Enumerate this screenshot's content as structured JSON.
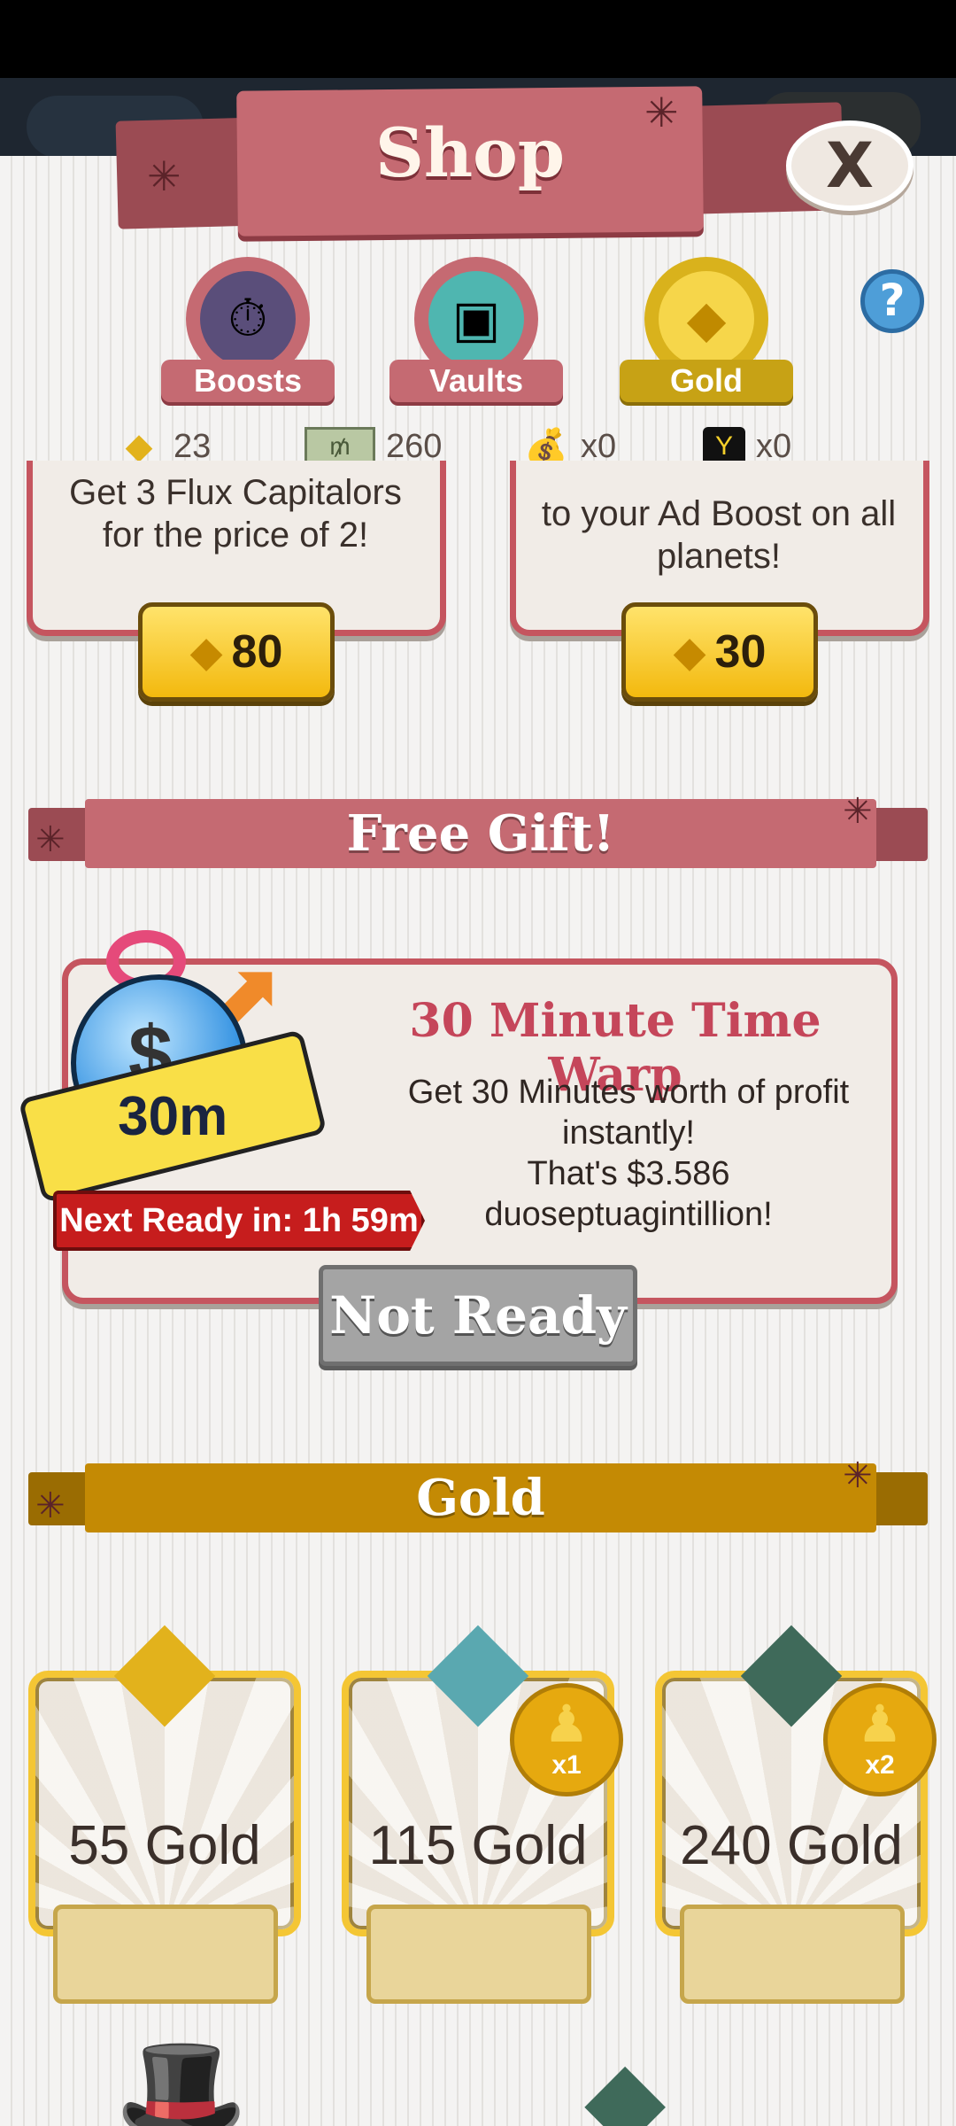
{
  "header": {
    "title": "Shop"
  },
  "tabs": [
    {
      "label": "Boosts",
      "icon": "boost-stopwatch-icon"
    },
    {
      "label": "Vaults",
      "icon": "vault-icon"
    },
    {
      "label": "Gold",
      "icon": "gold-gem-icon",
      "active": true
    }
  ],
  "currencies": [
    {
      "icon": "gold-gem-icon",
      "value": "23"
    },
    {
      "icon": "megabucks-icon",
      "value": "260"
    },
    {
      "icon": "money-bag-icon",
      "value": "x0"
    },
    {
      "icon": "ticket-icon",
      "value": "x0"
    }
  ],
  "top_cards": [
    {
      "text": "Get 3 Flux Capitalors for the price of 2!",
      "price": "80"
    },
    {
      "text": "to your Ad Boost on all planets!",
      "price": "30"
    }
  ],
  "free_gift": {
    "section_title": "Free Gift!",
    "title": "30 Minute Time Warp",
    "desc_line1": "Get 30 Minutes worth of profit instantly!",
    "desc_line2": "That's $3.586 duoseptuagintillion!",
    "ribbon": "30m",
    "next_ready": "Next Ready in: 1h 59m",
    "button": "Not Ready"
  },
  "gold_section": {
    "title": "Gold",
    "packs": [
      {
        "label": "55 Gold"
      },
      {
        "label": "115 Gold",
        "badge": "x1"
      },
      {
        "label": "240 Gold",
        "badge": "x2"
      }
    ]
  },
  "colors": {
    "accent_red": "#c56a72",
    "gold": "#c7a215",
    "panel": "#f4f3f2"
  }
}
